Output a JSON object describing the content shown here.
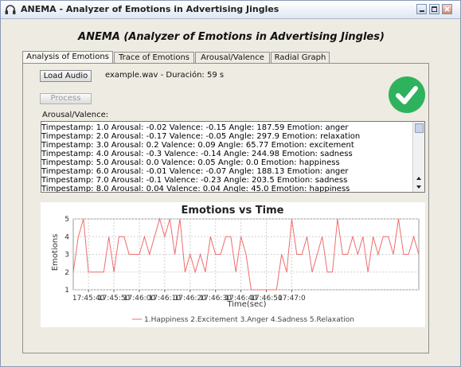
{
  "window": {
    "title": "ANEMA - Analyzer of Emotions in Advertising Jingles",
    "minimize": "_",
    "maximize": "□",
    "close": "×"
  },
  "header": {
    "title": "ANEMA (Analyzer of Emotions in Advertising Jingles)"
  },
  "tabs": [
    {
      "label": "Analysis of Emotions",
      "active": true
    },
    {
      "label": "Trace of Emotions",
      "active": false
    },
    {
      "label": "Arousal/Valence",
      "active": false
    },
    {
      "label": "Radial Graph",
      "active": false
    }
  ],
  "controls": {
    "load_label": "Load Audio",
    "file_info": "example.wav - Duración: 59 s",
    "process_label": "Process",
    "section_label": "Arousal/Valence:"
  },
  "log": {
    "lines": [
      "Timpestamp: 1.0 Arousal: -0.02 Valence: -0.15 Angle: 187.59 Emotion: anger",
      "Timpestamp: 2.0 Arousal: -0.17 Valence: -0.05 Angle: 297.9 Emotion: relaxation",
      "Timpestamp: 3.0 Arousal: 0.2 Valence: 0.09 Angle: 65.77 Emotion: excitement",
      "Timpestamp: 4.0 Arousal: -0.3 Valence: -0.14 Angle: 244.98 Emotion: sadness",
      "Timpestamp: 5.0 Arousal: 0.0 Valence: 0.05 Angle: 0.0 Emotion: happiness",
      "Timpestamp: 6.0 Arousal: -0.01 Valence: -0.07 Angle: 188.13 Emotion: anger",
      "Timpestamp: 7.0 Arousal: -0.1 Valence: -0.23 Angle: 203.5 Emotion: sadness",
      "Timpestamp: 8.0 Arousal: 0.04 Valence: 0.04 Angle: 45.0 Emotion: happiness"
    ]
  },
  "colors": {
    "line": "#f06c6c",
    "check": "#2fb25d"
  },
  "chart_data": {
    "type": "line",
    "title": "Emotions vs Time",
    "xlabel": "Time(sec)",
    "ylabel": "Emotions",
    "ylim": [
      1,
      5
    ],
    "yticks": [
      1,
      2,
      3,
      4,
      5
    ],
    "xticks": [
      "17:45:40",
      "17:45:50",
      "17:46:00",
      "17:46:10",
      "17:46:20",
      "17:46:30",
      "17:46:40",
      "17:46:50",
      "17:47:0"
    ],
    "legend": "1.Happiness 2.Excitement 3.Anger 4.Sadness 5.Relaxation",
    "legend_position": "bottom",
    "grid": true,
    "x_seconds": [
      34,
      36,
      38,
      40,
      42,
      44,
      46,
      48,
      50,
      52,
      54,
      56,
      58,
      60,
      62,
      64,
      66,
      68,
      70,
      72,
      74,
      76,
      78,
      80,
      82,
      84,
      86,
      88,
      90,
      92,
      94,
      96,
      98,
      100,
      102,
      104,
      106,
      108,
      110,
      112,
      114,
      116,
      118,
      120,
      122,
      124,
      126,
      128,
      130,
      132,
      134,
      136,
      138,
      140,
      142,
      144,
      146,
      148,
      150,
      152,
      154,
      156,
      158,
      160,
      162,
      164,
      166,
      168,
      170
    ],
    "values": [
      2,
      4,
      5,
      2,
      2,
      2,
      2,
      4,
      2,
      4,
      4,
      3,
      3,
      3,
      4,
      3,
      4,
      5,
      4,
      5,
      3,
      5,
      2,
      3,
      2,
      3,
      2,
      4,
      3,
      3,
      4,
      4,
      2,
      4,
      3,
      1,
      1,
      1,
      1,
      1,
      1,
      3,
      2,
      5,
      3,
      3,
      4,
      2,
      3,
      4,
      2,
      2,
      5,
      3,
      3,
      4,
      3,
      4,
      2,
      4,
      3,
      4,
      4,
      3,
      5,
      3,
      3,
      4,
      3
    ]
  }
}
